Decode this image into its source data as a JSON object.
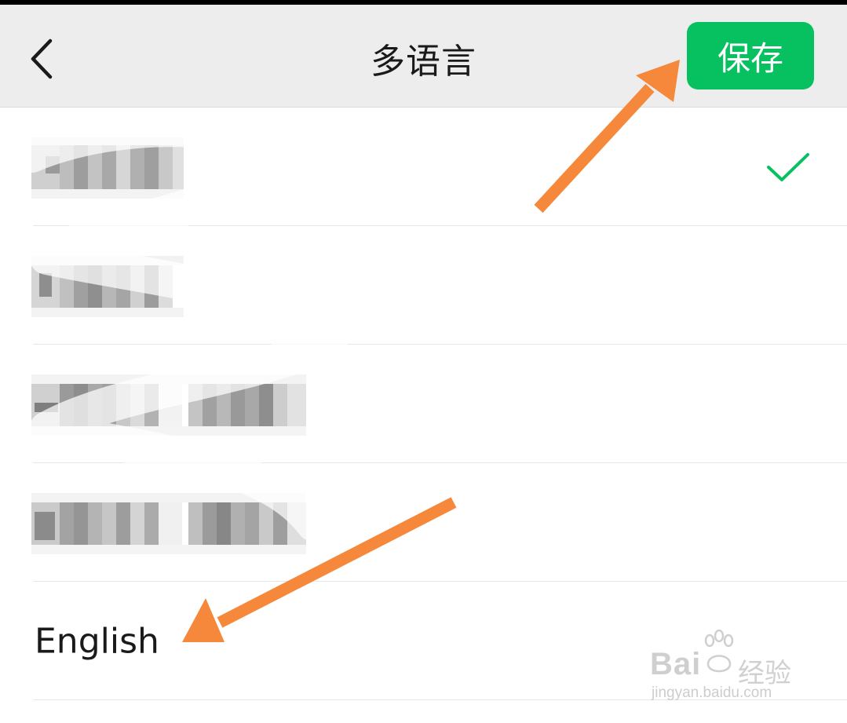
{
  "header": {
    "back_icon": "chevron-left-icon",
    "title": "多语言",
    "save_label": "保存"
  },
  "languages": [
    {
      "label": "",
      "obscured": true,
      "selected": true
    },
    {
      "label": "",
      "obscured": true,
      "selected": false
    },
    {
      "label": "",
      "obscured": true,
      "selected": false
    },
    {
      "label": "",
      "obscured": true,
      "selected": false
    },
    {
      "label": "English",
      "obscured": false,
      "selected": false
    }
  ],
  "selected_icon": "checkmark-icon",
  "annotations": {
    "arrow_color": "#f5883a",
    "arrows": [
      "arrow-to-save-button",
      "arrow-to-english-option"
    ]
  },
  "watermark": {
    "brand": "Bai",
    "brand_cn": "经验",
    "url": "jingyan.baidu.com"
  },
  "colors": {
    "accent": "#07c160",
    "header_bg": "#ededed",
    "divider": "#e6e6e6",
    "text": "#1a1a1a"
  }
}
